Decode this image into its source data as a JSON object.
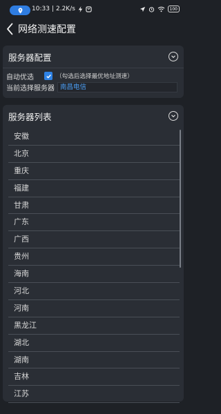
{
  "status_bar": {
    "time": "10:33",
    "speed": "2.2K/s",
    "battery": "100"
  },
  "header": {
    "title": "网络测速配置"
  },
  "server_config": {
    "title": "服务器配置",
    "auto_label": "自动优选",
    "auto_checked": true,
    "auto_hint": "（勾选后选择最优地址测速）",
    "current_label": "当前选择服务器",
    "current_value": "南昌电信"
  },
  "server_list": {
    "title": "服务器列表",
    "items": [
      "安徽",
      "北京",
      "重庆",
      "福建",
      "甘肃",
      "广东",
      "广西",
      "贵州",
      "海南",
      "河北",
      "河南",
      "黑龙江",
      "湖北",
      "湖南",
      "吉林",
      "江苏"
    ]
  },
  "colors": {
    "accent": "#2f83e6",
    "background": "#1e2126",
    "card": "#2a2e35"
  }
}
